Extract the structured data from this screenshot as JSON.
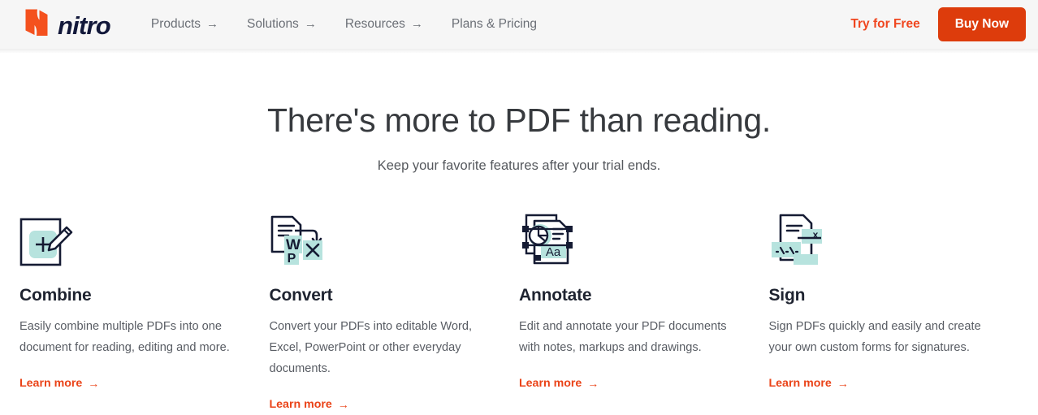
{
  "header": {
    "logo": {
      "mark_icon": "nitro-n-mark-icon",
      "wordmark": "nitro",
      "mark_color": "#f4511e",
      "word_color": "#12183a"
    },
    "nav": [
      {
        "label": "Products",
        "has_arrow": true,
        "arrow_glyph": "→"
      },
      {
        "label": "Solutions",
        "has_arrow": true,
        "arrow_glyph": "→"
      },
      {
        "label": "Resources",
        "has_arrow": true,
        "arrow_glyph": "→"
      },
      {
        "label": "Plans & Pricing",
        "has_arrow": false,
        "arrow_glyph": ""
      }
    ],
    "actions": {
      "try_label": "Try for Free",
      "buy_label": "Buy Now",
      "accent_color": "#dd3c0c"
    },
    "background_color": "#f6f6f6"
  },
  "hero": {
    "title": "There's more to PDF than reading.",
    "subtitle": "Keep your favorite features after your trial ends."
  },
  "features": {
    "learn_more_label": "Learn more",
    "learn_more_arrow": "→",
    "accent_color": "#ea4318",
    "icon_ink_color": "#151b33",
    "icon_accent_color": "#b7e3de",
    "cards": [
      {
        "icon": "combine-document-plus-pencil-icon",
        "title": "Combine",
        "desc": "Easily combine multiple PDFs into one document for reading, editing and more."
      },
      {
        "icon": "convert-document-to-office-formats-icon",
        "title": "Convert",
        "desc": "Convert your PDFs into editable Word, Excel, PowerPoint or other everyday documents."
      },
      {
        "icon": "annotate-document-markup-icon",
        "title": "Annotate",
        "desc": "Edit and annotate your PDF documents with notes, markups and drawings."
      },
      {
        "icon": "sign-document-signature-icon",
        "title": "Sign",
        "desc": "Sign PDFs quickly and easily and create your own custom forms for signatures."
      }
    ]
  }
}
